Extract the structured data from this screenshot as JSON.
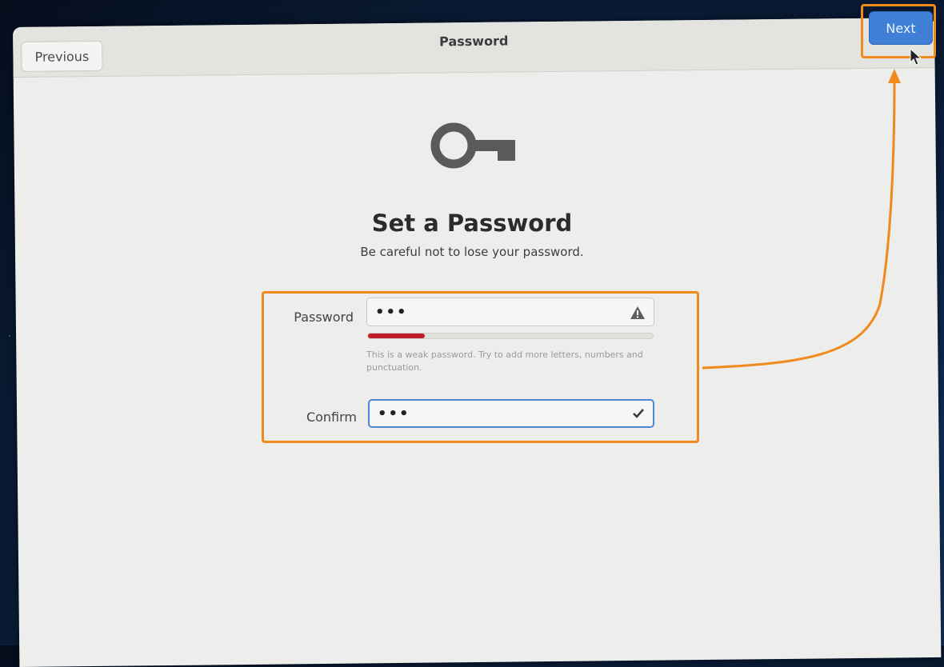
{
  "header": {
    "previous_label": "Previous",
    "title": "Password",
    "next_label": "Next"
  },
  "main": {
    "icon": "key-icon",
    "heading": "Set a Password",
    "subheading": "Be careful not to lose your password."
  },
  "form": {
    "password": {
      "label": "Password",
      "value": "•••",
      "status_icon": "warning-icon",
      "strength": 0.2,
      "hint": "This is a weak password. Try to add more letters, numbers and punctuation."
    },
    "confirm": {
      "label": "Confirm",
      "value": "•••",
      "status_icon": "checkmark-icon"
    }
  },
  "colors": {
    "accent": "#3f7fd6",
    "annotation": "#f08a1c",
    "weak": "#c01c28"
  }
}
